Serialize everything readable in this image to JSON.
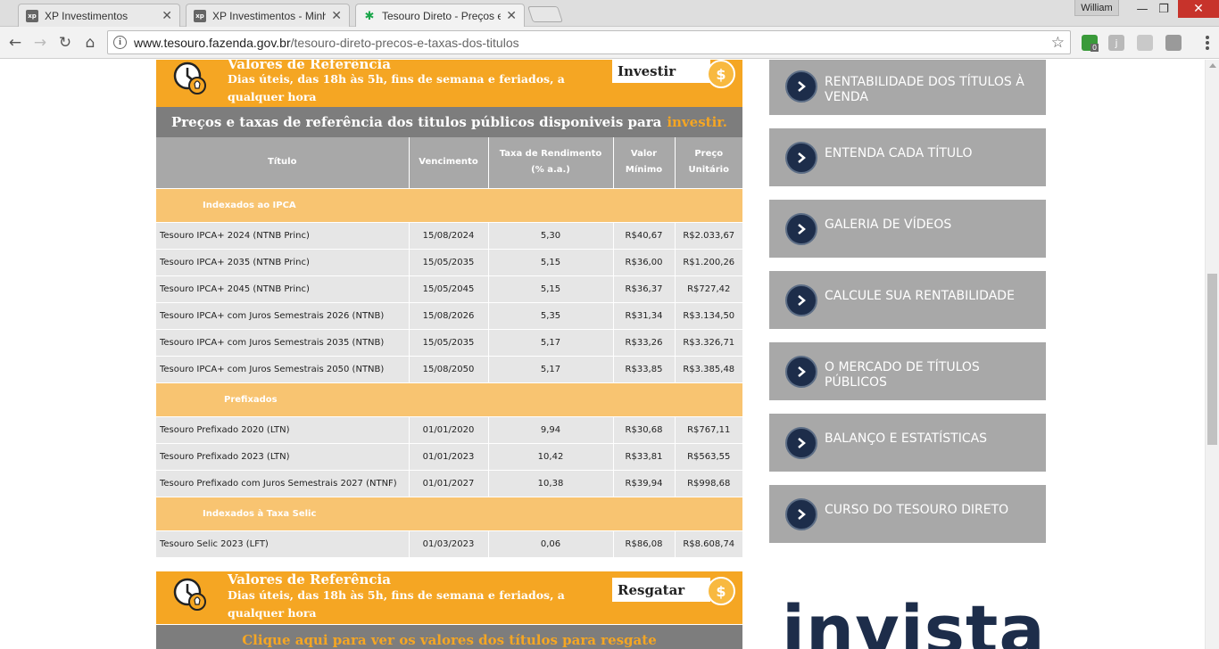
{
  "browser": {
    "tabs": [
      {
        "title": "XP Investimentos",
        "favicon": "xp-favicon"
      },
      {
        "title": "XP Investimentos - Minha",
        "favicon": "xp-favicon"
      },
      {
        "title": "Tesouro Direto - Preços e",
        "favicon": "palm-tree-favicon"
      }
    ],
    "fav_xp": "xp",
    "fav_palm": "✱",
    "user": "William",
    "url_host": "www.tesouro.fazenda.gov.br",
    "url_path": "/tesouro-direto-precos-e-taxas-dos-titulos",
    "ext_badge": "0",
    "ext_j": "j"
  },
  "reference": {
    "title": "Valores de Referência",
    "subtitle": "Dias úteis, das 18h às 5h, fins de semana e feriados, a qualquer hora",
    "invest_label": "Investir",
    "redeem_label": "Resgatar"
  },
  "invest_banner": {
    "text": "Preços e taxas de referência dos titulos públicos disponiveis para",
    "highlight": "investir."
  },
  "table": {
    "headers": {
      "title": "Título",
      "maturity": "Vencimento",
      "rate_l1": "Taxa de Rendimento",
      "rate_l2": "(% a.a.)",
      "min_l1": "Valor",
      "min_l2": "Mínimo",
      "unit_l1": "Preço",
      "unit_l2": "Unitário"
    },
    "groups": [
      {
        "name": "Indexados ao IPCA",
        "rows": [
          {
            "title": "Tesouro IPCA+ 2024 (NTNB Princ)",
            "maturity": "15/08/2024",
            "rate": "5,30",
            "min": "R$40,67",
            "unit": "R$2.033,67"
          },
          {
            "title": "Tesouro IPCA+ 2035 (NTNB Princ)",
            "maturity": "15/05/2035",
            "rate": "5,15",
            "min": "R$36,00",
            "unit": "R$1.200,26"
          },
          {
            "title": "Tesouro IPCA+ 2045 (NTNB Princ)",
            "maturity": "15/05/2045",
            "rate": "5,15",
            "min": "R$36,37",
            "unit": "R$727,42"
          },
          {
            "title": "Tesouro IPCA+ com Juros Semestrais 2026 (NTNB)",
            "maturity": "15/08/2026",
            "rate": "5,35",
            "min": "R$31,34",
            "unit": "R$3.134,50"
          },
          {
            "title": "Tesouro IPCA+ com Juros Semestrais 2035 (NTNB)",
            "maturity": "15/05/2035",
            "rate": "5,17",
            "min": "R$33,26",
            "unit": "R$3.326,71"
          },
          {
            "title": "Tesouro IPCA+ com Juros Semestrais 2050 (NTNB)",
            "maturity": "15/08/2050",
            "rate": "5,17",
            "min": "R$33,85",
            "unit": "R$3.385,48"
          }
        ]
      },
      {
        "name": "Prefixados",
        "rows": [
          {
            "title": "Tesouro Prefixado 2020 (LTN)",
            "maturity": "01/01/2020",
            "rate": "9,94",
            "min": "R$30,68",
            "unit": "R$767,11"
          },
          {
            "title": "Tesouro Prefixado 2023 (LTN)",
            "maturity": "01/01/2023",
            "rate": "10,42",
            "min": "R$33,81",
            "unit": "R$563,55"
          },
          {
            "title": "Tesouro Prefixado com Juros Semestrais 2027 (NTNF)",
            "maturity": "01/01/2027",
            "rate": "10,38",
            "min": "R$39,94",
            "unit": "R$998,68"
          }
        ]
      },
      {
        "name": "Indexados à Taxa Selic",
        "rows": [
          {
            "title": "Tesouro Selic 2023 (LFT)",
            "maturity": "01/03/2023",
            "rate": "0,06",
            "min": "R$86,08",
            "unit": "R$8.608,74"
          }
        ]
      }
    ]
  },
  "redeem_banner": {
    "text": "Clique aqui para ver os valores dos títulos para resgate"
  },
  "sidebar": {
    "items": [
      {
        "label": "RENTABILIDADE DOS TÍTULOS À VENDA"
      },
      {
        "label": "ENTENDA CADA TÍTULO"
      },
      {
        "label": "GALERIA DE VÍDEOS"
      },
      {
        "label": "CALCULE SUA RENTABILIDADE"
      },
      {
        "label": "O MERCADO DE TÍTULOS PÚBLICOS"
      },
      {
        "label": "BALANÇO E ESTATÍSTICAS"
      },
      {
        "label": "CURSO DO TESOURO DIRETO"
      }
    ]
  },
  "brand": {
    "invista": "invista"
  },
  "colors": {
    "orange": "#f5a623",
    "light_orange": "#f8c471",
    "navy": "#1d2d4a",
    "gray": "#a8a8a8"
  }
}
